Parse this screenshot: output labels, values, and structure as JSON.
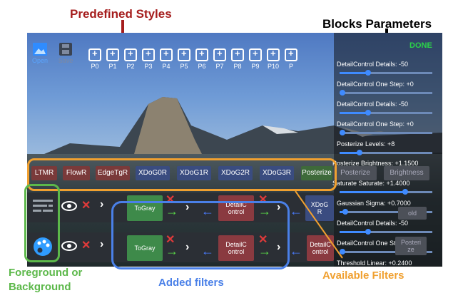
{
  "callouts": {
    "predefined_styles": "Predefined Styles",
    "blocks_parameters": "Blocks Parameters",
    "foreground_line1": "Foreground or",
    "foreground_line2": "Background",
    "added_filters": "Added filters",
    "available_filters": "Available Filters"
  },
  "toolbar": {
    "open": "Open",
    "save": "Save",
    "done": "DONE"
  },
  "styles": [
    "P0",
    "P1",
    "P2",
    "P3",
    "P4",
    "P5",
    "P6",
    "P7",
    "P8",
    "P9",
    "P10",
    "P"
  ],
  "params": [
    "DetailControl Details: -50",
    "DetailControl One Step: +0",
    "DetailControl Details: -50",
    "DetailControl One Step: +0",
    "Posterize Levels: +8",
    "Posterize Brightness: +1.1500",
    "Saturate Saturate: +1.4000",
    "Gaussian Sigma: +0.7000",
    "DetailControl Details: -50",
    "DetailControl One Step: +0",
    "Threshold Linear: +0.2400"
  ],
  "available_filters": [
    "LTMR",
    "FlowR",
    "EdgeTgR",
    "XDoG0R",
    "XDoG1R",
    "XDoG2R",
    "XDoG3R",
    "Posterize",
    "Posterize",
    "Brightness"
  ],
  "rows": {
    "row1": {
      "box1": "ToGray",
      "box2_line1": "DetailC",
      "box2_line2": "ontrol",
      "box3_line1": "XDoG",
      "box3_line2": "R",
      "box4": "old"
    },
    "row2": {
      "box1": "ToGray",
      "box2_line1": "DetailC",
      "box2_line2": "ontrol",
      "box3_line1": "DetailC",
      "box3_line2": "ontrol",
      "box4_line1": "Posteri",
      "box4_line2": "ze"
    }
  }
}
